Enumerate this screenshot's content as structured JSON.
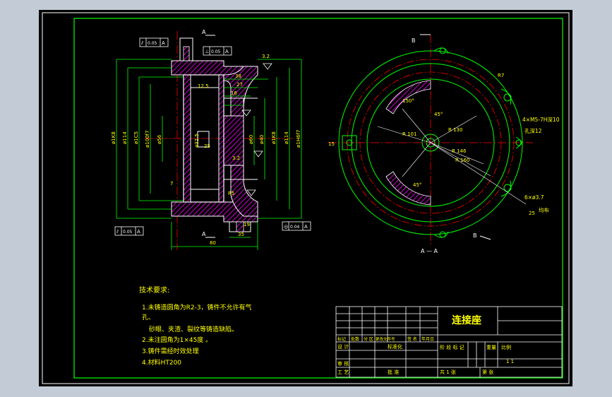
{
  "colors": {
    "background": "#000000",
    "frame": "#00ff00",
    "outline": "#ffffff",
    "dimension": "#00ff00",
    "text": "#ffff00",
    "center_line": "#ff0000",
    "hatch": "#ff00ff"
  },
  "title_block": {
    "part_name": "连接座",
    "header_cells": [
      "标记",
      "处数",
      "分 区",
      "更改文件号",
      "签 名",
      "年月日"
    ],
    "row_design": "设 计",
    "row_standard": "标准化",
    "stage_label": "阶 段 标 记",
    "weight_label": "重量",
    "scale_label": "比例",
    "scale_value": "1 1",
    "audit": "审 核",
    "process": "工 艺",
    "approve": "批 准",
    "sheets_total": "共 1 张",
    "sheet_no": "第 张"
  },
  "technical_requirements": {
    "heading": "技术要求:",
    "items": [
      "1.未铸造圆角为R2-3，铸件不允许有气",
      "孔、",
      "砂眼、夹渣、裂纹等铸造缺陷。",
      "2.未注圆角为1×45度 。",
      "3.铸件需经时效处理",
      "4.材料HT200"
    ]
  },
  "section_labels": {
    "cut_a_top": "A",
    "cut_a_bottom": "A",
    "cut_b_top": "B",
    "cut_b_bottom": "B",
    "view_a": "A — A"
  },
  "tolerance_frames": [
    {
      "symbol": "⫽",
      "value": "0.05",
      "datum": "A"
    },
    {
      "symbol": "⊥",
      "value": "0.05",
      "datum": "A"
    },
    {
      "symbol": "⫽",
      "value": "0.05",
      "datum": "A"
    },
    {
      "symbol": "◎",
      "value": "0.04",
      "datum": "A"
    }
  ],
  "section_dims": {
    "d_left": [
      "ø1K8",
      "ø114",
      "ø1C5",
      "ø100f7",
      "ø56"
    ],
    "d_right": [
      "ø60",
      "ø40",
      "ø1K8",
      "ø114",
      "ø1H6f7"
    ],
    "d_inner": [
      "ø32.5",
      "R5"
    ],
    "horizontal": [
      "38",
      "27",
      "16",
      "7",
      "80",
      "35",
      "19"
    ],
    "roughness": [
      "3.2",
      "12.5",
      "25",
      "3.2"
    ]
  },
  "plan_dims": {
    "angles": [
      "150°",
      "45°",
      "45°"
    ],
    "radii": [
      "R 101",
      "R 130",
      "R 146",
      "R 160"
    ],
    "holes": [
      "4×M5-7H深10",
      "孔深12",
      "6×ø3.7"
    ],
    "distribution": "均布",
    "misc": [
      "R7",
      "15",
      "25"
    ]
  }
}
